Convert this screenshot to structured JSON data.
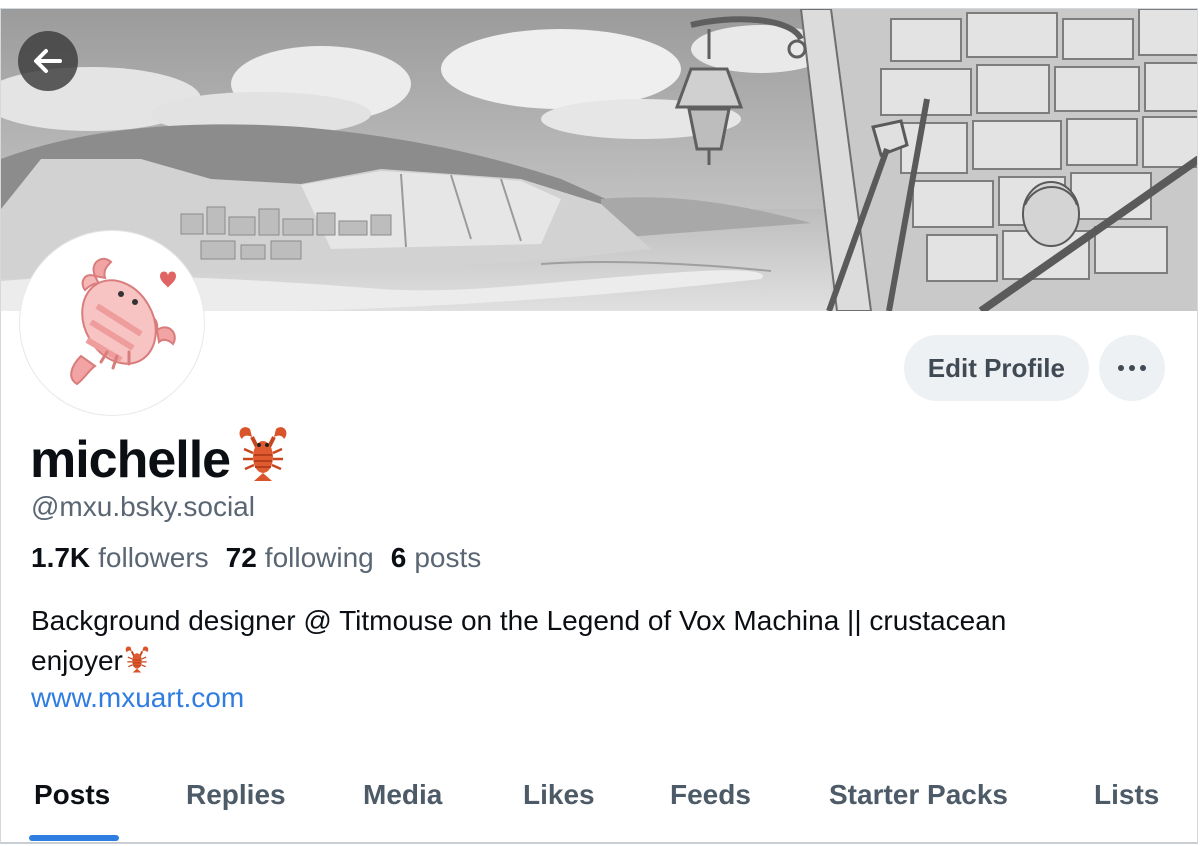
{
  "profile": {
    "display_name": "michelle",
    "handle": "@mxu.bsky.social",
    "stats": {
      "followers_count": "1.7K",
      "followers_label": "followers",
      "following_count": "72",
      "following_label": "following",
      "posts_count": "6",
      "posts_label": "posts"
    },
    "bio_line1": "Background designer @ Titmouse on the Legend of Vox Machina || crustacean",
    "bio_line2": "enjoyer",
    "website": "www.mxuart.com"
  },
  "actions": {
    "edit_profile_label": "Edit Profile"
  },
  "icons": {
    "back": "arrow-left-icon",
    "more": "ellipsis-icon",
    "name_emoji": "lobster-emoji",
    "bio_emoji": "lobster-emoji"
  },
  "tabs": [
    {
      "label": "Posts",
      "active": true
    },
    {
      "label": "Replies",
      "active": false
    },
    {
      "label": "Media",
      "active": false
    },
    {
      "label": "Likes",
      "active": false
    },
    {
      "label": "Feeds",
      "active": false
    },
    {
      "label": "Starter Packs",
      "active": false
    },
    {
      "label": "Lists",
      "active": false
    }
  ],
  "colors": {
    "accent": "#2f7de1",
    "button_bg": "#eef1f4",
    "muted_text": "#5a6673"
  }
}
